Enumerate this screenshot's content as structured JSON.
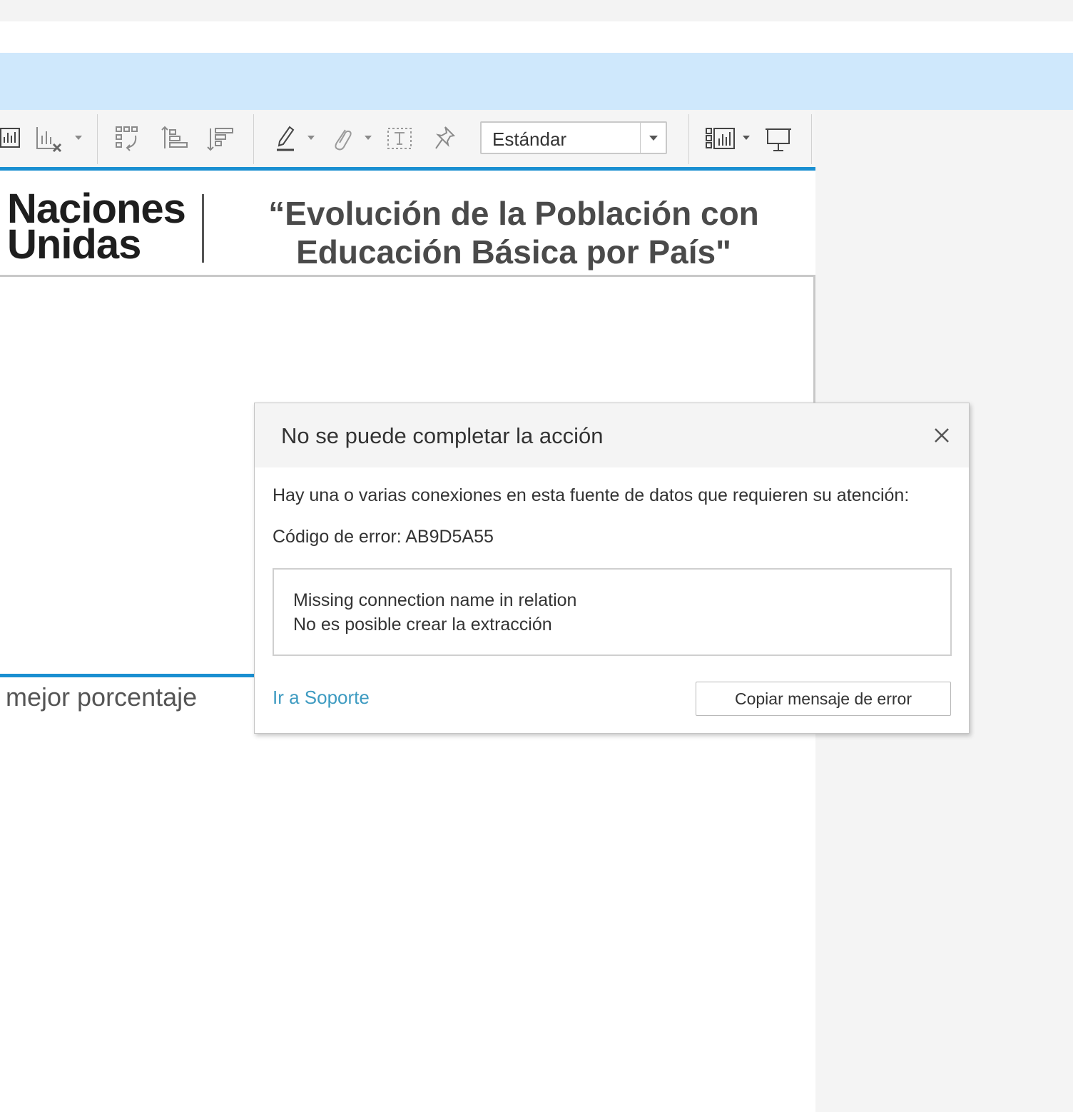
{
  "toolbar": {
    "mark_type": {
      "selected": "Estándar"
    },
    "icons": [
      "show-mark-labels-icon",
      "clear-sheet-icon",
      "swap-rows-columns-icon",
      "sort-ascending-icon",
      "sort-descending-icon",
      "highlight-icon",
      "group-members-icon",
      "show-labels-icon",
      "fix-axes-icon",
      "show-me-icon",
      "presentation-mode-icon"
    ]
  },
  "dashboard": {
    "logo_line1": "Naciones",
    "logo_line2": "Unidas",
    "title_line1": "“Evolución de la Población con",
    "title_line2": "Educación Básica por País\"",
    "subtitle_fragment": "mejor porcentaje"
  },
  "dialog": {
    "title": "No se puede completar la acción",
    "message": "Hay una o varias conexiones en esta fuente de datos que requieren su atención:",
    "error_code_label": "Código de error: ",
    "error_code": "AB9D5A55",
    "details": [
      "Missing connection name in relation",
      "No es posible crear la extracción"
    ],
    "support_link": "Ir a Soporte",
    "copy_button": "Copiar mensaje de error"
  },
  "colors": {
    "accent_blue": "#1a8fd1",
    "band_blue": "#cfe8fc",
    "link_blue": "#3e9bc1"
  }
}
